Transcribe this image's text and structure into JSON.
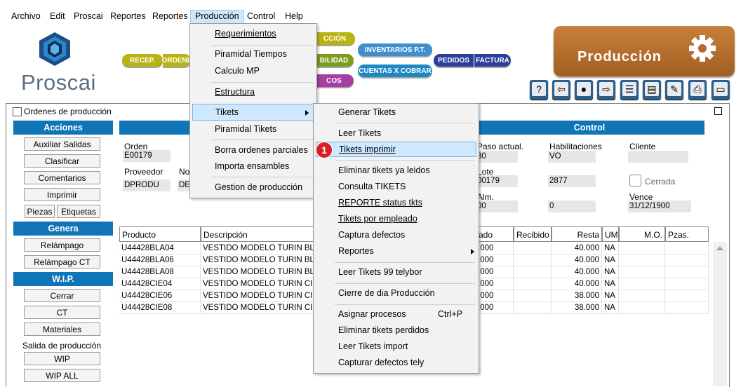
{
  "menubar": [
    "Archivo",
    "Edit",
    "Proscai",
    "Reportes",
    "Reportes",
    "Producción",
    "Control",
    "Help"
  ],
  "logo": {
    "name": "Proscai"
  },
  "nav_pills": {
    "recep": "RECEP.",
    "ordenes": "ORDENE",
    "produccion": "CCIÓN",
    "contabilidad": "BILIDAD",
    "cos": "COS",
    "inventarios": "INVENTARIOS P.T.",
    "cuentas": "CUENTAS X COBRAR",
    "pedidos": "PEDIDOS",
    "factura": "FACTURA"
  },
  "banner": {
    "title": "Producción"
  },
  "toolbar_icons": [
    "help-icon",
    "arrow-left-icon",
    "search-icon",
    "arrow-right-icon",
    "list-icon",
    "edit-list-icon",
    "edit-icon",
    "print-icon",
    "window-icon"
  ],
  "toolbar_glyphs": [
    "?",
    "⇦",
    "●",
    "⇨",
    "☰",
    "▤",
    "✎",
    "⎙",
    "▭"
  ],
  "window": {
    "title": "Ordenes de producción"
  },
  "sidebar": {
    "acciones": "Acciones",
    "acciones_items": [
      "Auxiliar Salidas",
      "Clasificar",
      "Comentarios",
      "Imprimir"
    ],
    "piezas": "Piezas",
    "etiquetas": "Etiquetas",
    "genera": "Genera",
    "genera_items": [
      "Relámpago",
      "Relámpago CT"
    ],
    "wip": "W.I.P.",
    "wip_items": [
      "Cerrar",
      "CT",
      "Materiales"
    ],
    "salida": "Salida de producción",
    "wip_btn": "WIP",
    "wip_all": "WIP ALL"
  },
  "control": {
    "header": "Control"
  },
  "form": {
    "orden_label": "Orden",
    "orden_value": "E00179",
    "proveedor_label": "Proveedor",
    "proveedor_value": "DPRODU",
    "no_label": "No",
    "no_value": "DE",
    "paso_label": "Paso actual.",
    "paso_value": "80",
    "habil_label": "Habilitaciones",
    "habil_value": "VO",
    "cliente_label": "Cliente",
    "lote_label": "Lote",
    "lote_value": "00179",
    "lote2_value": "2877",
    "cerrada_label": "Cerrada",
    "alm_label": "Alm.",
    "alm_value": "00",
    "alm2_value": "0",
    "vence_label": "Vence",
    "vence_value": "31/12/1900"
  },
  "grid": {
    "headers": [
      "Producto",
      "Descripción",
      "ado",
      "Recibido",
      "Resta",
      "UM",
      "M.O.",
      "Pzas."
    ],
    "rows": [
      [
        "U44428BLA04",
        "VESTIDO MODELO TURIN BLA C",
        ".000",
        "",
        "40.000",
        "NA"
      ],
      [
        "U44428BLA06",
        "VESTIDO MODELO TURIN BLA C",
        ".000",
        "",
        "40.000",
        "NA"
      ],
      [
        "U44428BLA08",
        "VESTIDO MODELO TURIN BLA C",
        ".000",
        "",
        "40.000",
        "NA"
      ],
      [
        "U44428CIE04",
        "VESTIDO MODELO TURIN CIE C",
        ".000",
        "",
        "40.000",
        "NA"
      ],
      [
        "U44428CIE06",
        "VESTIDO MODELO TURIN CIE C",
        ".000",
        "",
        "38.000",
        "NA"
      ],
      [
        "U44428CIE08",
        "VESTIDO MODELO TURIN CIE C",
        ".000",
        "",
        "38.000",
        "NA"
      ]
    ]
  },
  "produccion_menu": [
    "Requerimientos",
    "Piramidal Tiempos",
    "Calculo MP",
    "Estructura",
    "Tikets",
    "Piramidal Tikets",
    "Borra ordenes parciales",
    "Importa ensambles",
    "Gestion de producción"
  ],
  "tikets_menu": [
    "Generar Tikets",
    "Leer Tikets",
    "Tikets imprimir",
    "Eliminar tikets ya leidos",
    "Consulta TIKETS",
    "REPORTE status tkts",
    "Tikets por empleado",
    "Captura defectos",
    "Reportes",
    "Leer Tikets 99 telybor",
    "Cierre de dia Producción",
    "Asignar procesos",
    "Eliminar tikets perdidos",
    "Leer Tikets import",
    "Capturar defectos tely"
  ],
  "shortcut": "Ctrl+P",
  "step_badge": "1"
}
